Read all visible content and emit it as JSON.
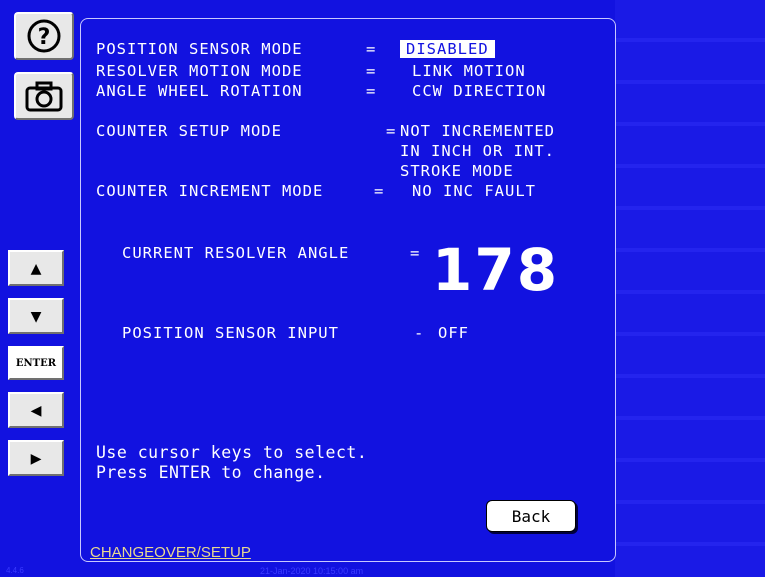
{
  "toolbar": {
    "help_icon": "question-circle",
    "camera_icon": "camera"
  },
  "settings": {
    "position_sensor_mode": {
      "label": "POSITION SENSOR MODE",
      "sep": "=",
      "value": "DISABLED"
    },
    "resolver_motion_mode": {
      "label": "RESOLVER MOTION MODE",
      "sep": "=",
      "value": "LINK MOTION"
    },
    "angle_wheel_rotation": {
      "label": "ANGLE WHEEL ROTATION",
      "sep": "=",
      "value": "CCW DIRECTION"
    },
    "counter_setup_mode": {
      "label": "COUNTER SETUP MODE",
      "sep": "=",
      "value_line1": "NOT INCREMENTED",
      "value_line2": "IN INCH OR INT.",
      "value_line3": "STROKE MODE"
    },
    "counter_increment_mode": {
      "label": "COUNTER INCREMENT MODE",
      "sep": "=",
      "value": "NO INC FAULT"
    }
  },
  "resolver": {
    "label": "CURRENT RESOLVER ANGLE",
    "sep": "=",
    "angle": "178"
  },
  "sensor_input": {
    "label": "POSITION SENSOR INPUT",
    "sep": "-",
    "value": "OFF"
  },
  "instructions": {
    "line1": "Use cursor keys to select.",
    "line2": "Press ENTER to change."
  },
  "nav_buttons": {
    "up": "▲",
    "down": "▼",
    "enter": "ENTER",
    "left": "◀",
    "right": "▶"
  },
  "back_label": "Back",
  "breadcrumb": "CHANGEOVER/SETUP",
  "status_bar": {
    "version": "4.4.6",
    "datetime": "21-Jan-2020 10:15:00 am"
  },
  "colors": {
    "background": "#1212e0",
    "text": "#ffffff",
    "highlight": "#ffffff",
    "breadcrumb": "#e8d890"
  }
}
